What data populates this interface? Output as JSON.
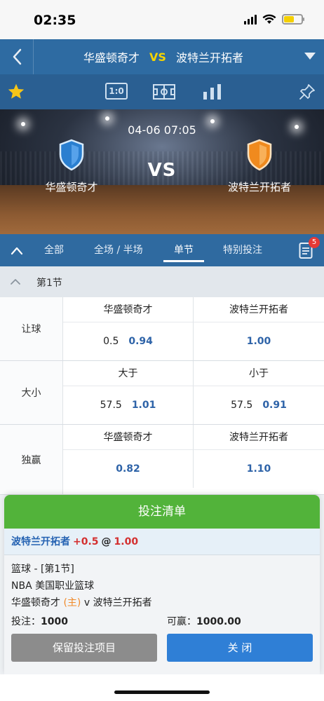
{
  "status_bar": {
    "time": "02:35"
  },
  "header": {
    "home_team": "华盛顿奇才",
    "vs": "VS",
    "away_team": "波特兰开拓者"
  },
  "toolbar": {
    "score_label": "1:0"
  },
  "banner": {
    "datetime": "04-06 07:05",
    "vs": "VS",
    "home_team": "华盛顿奇才",
    "away_team": "波特兰开拓者"
  },
  "tabs": {
    "items": [
      {
        "label": "全部"
      },
      {
        "label": "全场 / 半场"
      },
      {
        "label": "单节"
      },
      {
        "label": "特别投注"
      }
    ],
    "active_index": 2,
    "betslip_badge": "5"
  },
  "section": {
    "title": "第1节"
  },
  "markets": [
    {
      "label": "让球",
      "left": {
        "head": "华盛顿奇才",
        "line": "0.5",
        "odds": "0.94"
      },
      "right": {
        "head": "波特兰开拓者",
        "line": "",
        "odds": "1.00"
      }
    },
    {
      "label": "大小",
      "left": {
        "head": "大于",
        "line": "57.5",
        "odds": "1.01"
      },
      "right": {
        "head": "小于",
        "line": "57.5",
        "odds": "0.91"
      }
    },
    {
      "label": "独赢",
      "left": {
        "head": "华盛顿奇才",
        "line": "",
        "odds": "0.82"
      },
      "right": {
        "head": "波特兰开拓者",
        "line": "",
        "odds": "1.10"
      }
    }
  ],
  "bet_slip": {
    "title": "投注清单",
    "selection_team": "波特兰开拓者",
    "selection_line": "+0.5",
    "selection_at": "@",
    "selection_odds": "1.00",
    "sport_period": "篮球 - [第1节]",
    "league": "NBA 美国职业篮球",
    "match_home": "华盛顿奇才",
    "home_tag": "(主)",
    "match_v": "v",
    "match_away": "波特兰开拓者",
    "stake_label": "投注：",
    "stake_value": "1000",
    "win_label": "可赢：",
    "win_value": "1000.00",
    "keep_button": "保留投注项目",
    "close_button": "关 闭"
  },
  "colors": {
    "header_blue": "#2e6ba2",
    "accent_green": "#52b33a",
    "odds_blue": "#2e63a8",
    "alert_red": "#d32f2f"
  }
}
